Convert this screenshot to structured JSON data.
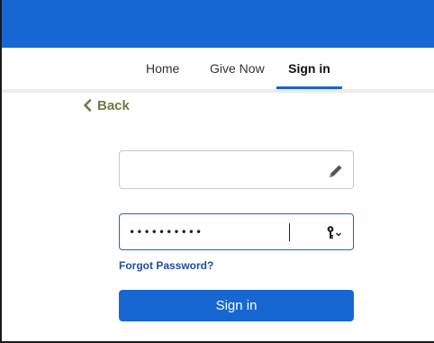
{
  "colors": {
    "brand_blue": "#1767d2",
    "back_link": "#6f7a3b",
    "link_blue": "#1f4fa0"
  },
  "nav": {
    "home_label": "Home",
    "give_now_label": "Give Now",
    "sign_in_label": "Sign in",
    "active": "Sign in"
  },
  "back": {
    "label": "Back",
    "icon": "chevron-left-icon"
  },
  "form": {
    "username": {
      "value": "",
      "placeholder": "",
      "icon": "pencil-icon"
    },
    "password": {
      "value": "••••••••••",
      "placeholder": "",
      "icon": "key-icon"
    },
    "forgot_label": "Forgot Password?",
    "submit_label": "Sign in"
  }
}
